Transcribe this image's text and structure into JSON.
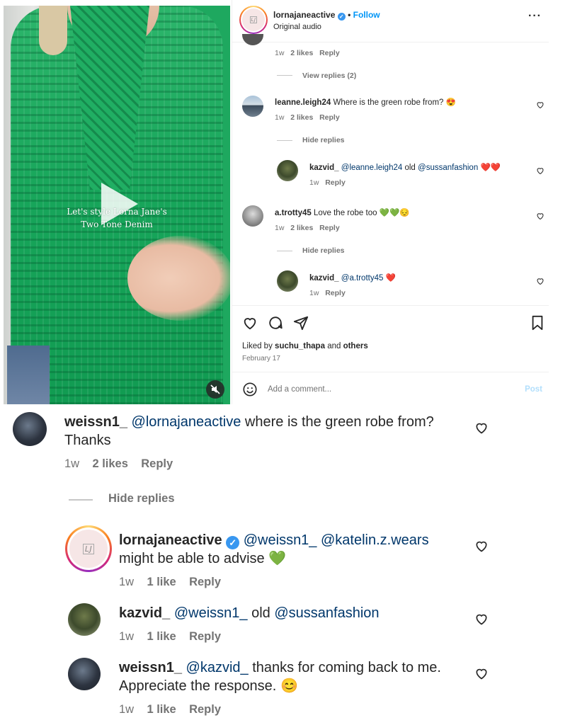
{
  "video": {
    "overlay_line1": "Let's style Lorna Jane's",
    "overlay_line2": "Two Tone Denim",
    "mute_icon": "mute-icon"
  },
  "header": {
    "username": "lornajaneactive",
    "dot": "•",
    "follow_label": "Follow",
    "subtitle": "Original audio",
    "more": "···",
    "logo_text": "LJ"
  },
  "comments_small": [
    {
      "meta_time": "1w",
      "meta_likes": "2 likes",
      "meta_reply": "Reply"
    }
  ],
  "view_replies_1": "View replies (2)",
  "comment_leanne": {
    "user": "leanne.leigh24",
    "text": "Where is the green robe from? 😍",
    "time": "1w",
    "likes": "2 likes",
    "reply": "Reply",
    "hide_replies": "Hide replies"
  },
  "reply_kazvid_1": {
    "user": "kazvid_",
    "mention1": "@leanne.leigh24",
    "word": "old",
    "mention2": "@sussanfashion",
    "emoji": "❤️❤️",
    "time": "1w",
    "reply": "Reply"
  },
  "comment_atrotty": {
    "user": "a.trotty45",
    "text": "Love the robe too",
    "emoji": "💚💚😔",
    "time": "1w",
    "likes": "2 likes",
    "reply": "Reply",
    "hide_replies": "Hide replies"
  },
  "reply_kazvid_2": {
    "user": "kazvid_",
    "mention": "@a.trotty45",
    "emoji": "❤️",
    "time": "1w",
    "reply": "Reply"
  },
  "actions": {
    "liked_by_prefix": "Liked by",
    "liked_user": "suchu_thapa",
    "and": "and",
    "others": "others",
    "date": "February 17",
    "add_comment_placeholder": "Add a comment...",
    "post_label": "Post"
  },
  "zoom": {
    "c1": {
      "user": "weissn1_",
      "mention": "@lornajaneactive",
      "text": "where is the green robe from?",
      "text2": "Thanks",
      "time": "1w",
      "likes": "2 likes",
      "reply": "Reply"
    },
    "hide_replies": "Hide replies",
    "c2": {
      "user": "lornajaneactive",
      "mention1": "@weissn1_",
      "mention2": "@katelin.z.wears",
      "text2": "might be able to advise",
      "emoji": "💚",
      "time": "1w",
      "likes": "1 like",
      "reply": "Reply"
    },
    "c3": {
      "user": "kazvid_",
      "mention1": "@weissn1_",
      "word": "old",
      "mention2": "@sussanfashion",
      "time": "1w",
      "likes": "1 like",
      "reply": "Reply"
    },
    "c4": {
      "user": "weissn1_",
      "mention": "@kazvid_",
      "text": "thanks for coming back to me.",
      "text2": "Appreciate the response.",
      "emoji": "😊",
      "time": "1w",
      "likes": "1 like",
      "reply": "Reply"
    }
  },
  "colors": {
    "link": "#00376b",
    "follow": "#0095f6",
    "muted": "#737373",
    "robe_green": "#1ea85f"
  }
}
